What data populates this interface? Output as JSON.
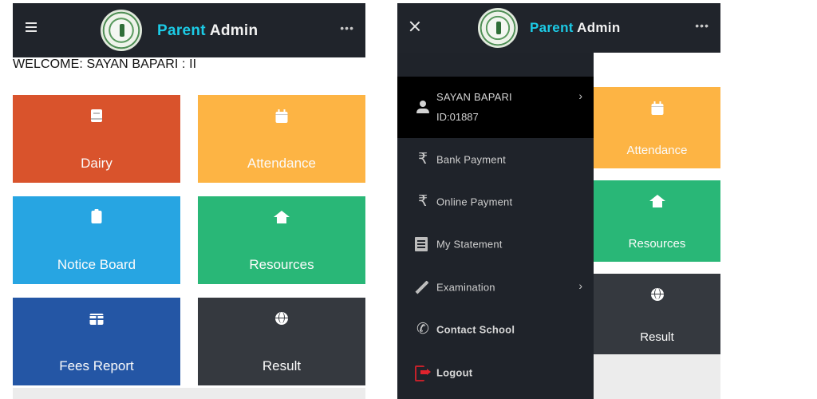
{
  "app": {
    "title_part1": "Parent",
    "title_part2": "Admin",
    "menu_icon": "hamburger-icon",
    "more_icon": "ellipsis-icon",
    "close_icon": "close-icon",
    "more_glyph": "•••"
  },
  "dashboard": {
    "welcome": "WELCOME: SAYAN BAPARI : II",
    "tiles": [
      {
        "label": "Dairy",
        "icon": "book-icon",
        "color": "#d9532c"
      },
      {
        "label": "Attendance",
        "icon": "calendar-icon",
        "color": "#fdb444"
      },
      {
        "label": "Notice Board",
        "icon": "clipboard-icon",
        "color": "#27a5e2"
      },
      {
        "label": "Resources",
        "icon": "home-icon",
        "color": "#29b777"
      },
      {
        "label": "Fees Report",
        "icon": "table-icon",
        "color": "#2456a5"
      },
      {
        "label": "Result",
        "icon": "globe-icon",
        "color": "#35393f"
      }
    ]
  },
  "drawer": {
    "user": {
      "name": "SAYAN BAPARI",
      "id": "ID:01887",
      "icon": "user-icon"
    },
    "items": [
      {
        "label": "Bank Payment",
        "icon": "rupee-icon",
        "glyph": "₹",
        "has_submenu": false
      },
      {
        "label": "Online Payment",
        "icon": "rupee-icon",
        "glyph": "₹",
        "has_submenu": false
      },
      {
        "label": "My Statement",
        "icon": "receipt-icon",
        "has_submenu": false
      },
      {
        "label": "Examination",
        "icon": "pencil-icon",
        "has_submenu": true
      },
      {
        "label": "Contact School",
        "icon": "phone-icon",
        "glyph": "✆",
        "has_submenu": false
      },
      {
        "label": "Logout",
        "icon": "logout-icon",
        "has_submenu": false
      }
    ],
    "chevron": "›"
  },
  "colors": {
    "header_bg": "#20242b",
    "drawer_bg": "#1f232a",
    "accent_cyan": "#1ccbe6",
    "logout_red": "#e0232d"
  }
}
